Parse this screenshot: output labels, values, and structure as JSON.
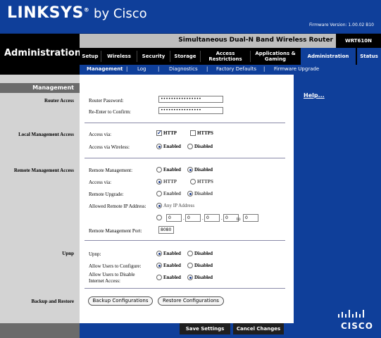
{
  "header": {
    "logo_main": "LINKSYS",
    "logo_reg": "®",
    "logo_by": " by Cisco",
    "firmware": "Firmware Version: 1.00.02 B10",
    "product_name": "Simultaneous Dual-N Band Wireless Router",
    "model": "WRT610N",
    "section_title": "Administration"
  },
  "tabs": [
    {
      "label": "Setup"
    },
    {
      "label": "Wireless"
    },
    {
      "label": "Security"
    },
    {
      "label": "Storage"
    },
    {
      "label": "Access\nRestrictions"
    },
    {
      "label": "Applications &\nGaming"
    },
    {
      "label": "Administration"
    },
    {
      "label": "Status"
    }
  ],
  "subtabs": [
    "Management",
    "Log",
    "Diagnostics",
    "Factory Defaults",
    "Firmware Upgrade"
  ],
  "sidebar": {
    "section": "Management",
    "router_access": "Router Access",
    "local_mgmt": "Local Management Access",
    "remote_mgmt": "Remote Management Access",
    "upnp": "Upnp",
    "backup": "Backup and Restore"
  },
  "help": "Help...",
  "router_access": {
    "password_label": "Router Password:",
    "password_value": "••••••••••••••••",
    "confirm_label": "Re-Enter to  Confirm:",
    "confirm_value": "••••••••••••••••"
  },
  "local": {
    "access_via_label": "Access via:",
    "http": "HTTP",
    "https": "HTTPS",
    "wireless_label": "Access via Wireless:",
    "enabled": "Enabled",
    "disabled": "Disabled"
  },
  "remote": {
    "mgmt_label": "Remote  Management:",
    "access_via_label": "Access via:",
    "upgrade_label": "Remote Upgrade:",
    "allowed_ip_label": "Allowed Remote IP Address:",
    "any_ip": "Any IP Address",
    "ip": [
      "0",
      "0",
      "0",
      "0"
    ],
    "to_label": "to",
    "to_value": "0",
    "port_label": "Remote Management Port:",
    "port_value": "8080",
    "enabled": "Enabled",
    "disabled": "Disabled",
    "http": "HTTP",
    "https": "HTTPS"
  },
  "upnp": {
    "upnp_label": "Upnp:",
    "allow_config_label": "Allow Users to Configure:",
    "allow_disable_label_1": "Allow Users to Disable",
    "allow_disable_label_2": "Internet Access:",
    "enabled": "Enabled",
    "disabled": "Disabled"
  },
  "backup": {
    "backup_btn": "Backup Configurations",
    "restore_btn": "Restore Configurations"
  },
  "footer": {
    "save": "Save Settings",
    "cancel": "Cancel Changes",
    "cisco": "CISCO"
  },
  "colors": {
    "brand_blue": "#0f3f9a",
    "black": "#000000",
    "panel_gray": "#d3d3d3"
  }
}
